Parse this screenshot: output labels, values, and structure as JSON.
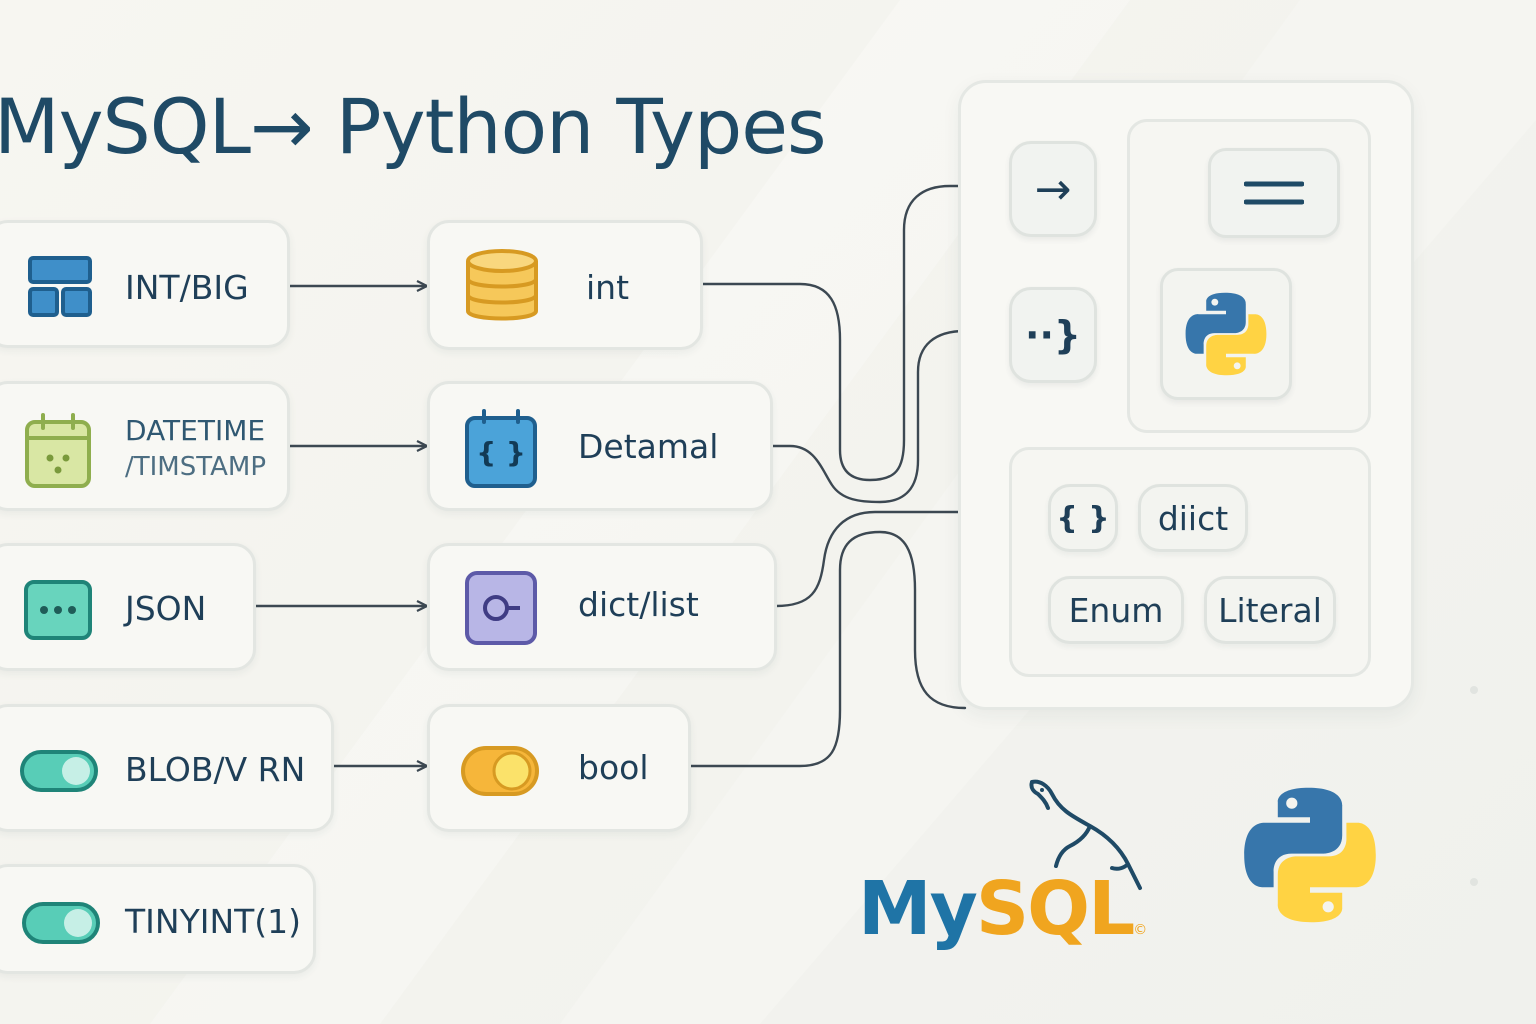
{
  "title": "MySQL→ Python Types",
  "mysql_types": [
    {
      "label": "INT/BIG",
      "icon": "grid-blocks-icon"
    },
    {
      "label": "DATETIME",
      "label2": "/TIMSTAMP",
      "icon": "calendar-icon"
    },
    {
      "label": "JSON",
      "icon": "dots-icon"
    },
    {
      "label": "BLOB/V RN",
      "icon": "toggle-icon"
    },
    {
      "label": "TINYINT(1)",
      "icon": "toggle-icon"
    }
  ],
  "python_types": [
    {
      "label": "int",
      "icon": "database-icon"
    },
    {
      "label": "Detamal",
      "icon": "braces-icon"
    },
    {
      "label": "dict/list",
      "icon": "circle-key-icon"
    },
    {
      "label": "bool",
      "icon": "toggle-knob-icon"
    }
  ],
  "panel": {
    "arrow_button": "→",
    "braces_button": "··}",
    "menu_icon": "menu-icon",
    "python_logo": "python-logo",
    "braces_pill": "{ }",
    "chips": [
      "diict",
      "Enum",
      "Literal"
    ]
  },
  "logos": {
    "mysql_my": "My",
    "mysql_sql": "SQL",
    "mysql_reg": "©",
    "python": "python-logo"
  },
  "colors": {
    "title": "#1f4a66",
    "text": "#1f3f58",
    "connector": "#3c4852",
    "blue": "#3f8fc9",
    "green": "#9bbf5a",
    "teal": "#58cdb7",
    "yellow": "#f6c85a",
    "purple": "#b8b6e6",
    "python_blue": "#3776ab",
    "python_yellow": "#ffd343",
    "mysql_blue": "#1f74a6",
    "mysql_orange": "#f0a51f"
  }
}
